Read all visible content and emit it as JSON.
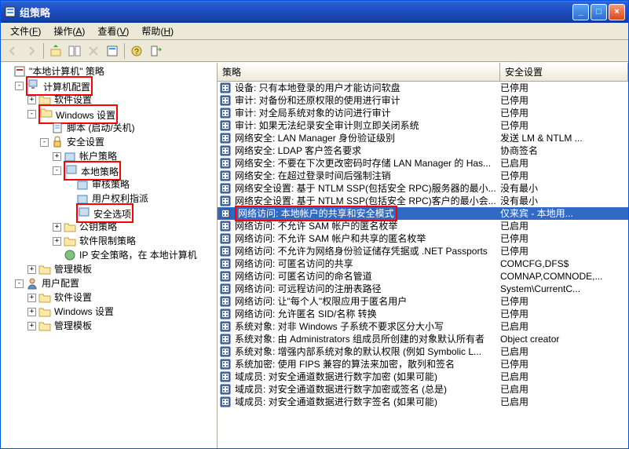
{
  "window": {
    "title": "组策略"
  },
  "menu": {
    "file": "文件",
    "file_u": "F",
    "action": "操作",
    "action_u": "A",
    "view": "查看",
    "view_u": "V",
    "help": "帮助",
    "help_u": "H"
  },
  "tree": {
    "root": "\"本地计算机\" 策略",
    "computer_config": "计算机配置",
    "software_settings": "软件设置",
    "windows_settings": "Windows 设置",
    "scripts": "脚本 (启动/关机)",
    "security_settings": "安全设置",
    "account_policy": "帐户策略",
    "local_policy": "本地策略",
    "audit_policy": "审核策略",
    "user_rights": "用户权利指派",
    "security_options": "安全选项",
    "public_key": "公钥策略",
    "software_restrict": "软件限制策略",
    "ip_security": "IP 安全策略，在 本地计算机",
    "admin_templates": "管理模板",
    "user_config": "用户配置",
    "software_settings2": "软件设置",
    "windows_settings2": "Windows 设置",
    "admin_templates2": "管理模板"
  },
  "list": {
    "header": {
      "policy": "策略",
      "security_setting": "安全设置"
    },
    "rows": [
      {
        "name": "设备: 只有本地登录的用户才能访问软盘",
        "value": "已停用"
      },
      {
        "name": "审计: 对备份和还原权限的使用进行审计",
        "value": "已停用"
      },
      {
        "name": "审计: 对全局系统对象的访问进行审计",
        "value": "已停用"
      },
      {
        "name": "审计: 如果无法纪录安全审计则立即关闭系统",
        "value": "已停用"
      },
      {
        "name": "网络安全: LAN Manager 身份验证级别",
        "value": "发送 LM & NTLM ..."
      },
      {
        "name": "网络安全: LDAP 客户签名要求",
        "value": "协商签名"
      },
      {
        "name": "网络安全: 不要在下次更改密码时存储 LAN Manager 的 Has...",
        "value": "已启用"
      },
      {
        "name": "网络安全: 在超过登录时间后强制注销",
        "value": "已停用"
      },
      {
        "name": "网络安全设置: 基于 NTLM SSP(包括安全 RPC)服务器的最小...",
        "value": "没有最小"
      },
      {
        "name": "网络安全设置: 基于 NTLM SSP(包括安全 RPC)客户的最小会...",
        "value": "没有最小"
      },
      {
        "name": "网络访问: 本地帐户的共享和安全模式",
        "value": "仅来宾 - 本地用...",
        "selected": true,
        "hl": true
      },
      {
        "name": "网络访问: 不允许 SAM 帐户的匿名枚举",
        "value": "已启用"
      },
      {
        "name": "网络访问: 不允许 SAM 帐户和共享的匿名枚举",
        "value": "已停用"
      },
      {
        "name": "网络访问: 不允许为网络身份验证储存凭据或 .NET Passports",
        "value": "已停用"
      },
      {
        "name": "网络访问: 可匿名访问的共享",
        "value": "COMCFG,DFS$"
      },
      {
        "name": "网络访问: 可匿名访问的命名管道",
        "value": "COMNAP,COMNODE,..."
      },
      {
        "name": "网络访问: 可远程访问的注册表路径",
        "value": "System\\CurrentC..."
      },
      {
        "name": "网络访问: 让\"每个人\"权限应用于匿名用户",
        "value": "已停用"
      },
      {
        "name": "网络访问: 允许匿名 SID/名称 转换",
        "value": "已停用"
      },
      {
        "name": "系统对象: 对非 Windows 子系统不要求区分大小写",
        "value": "已启用"
      },
      {
        "name": "系统对象: 由 Administrators 组成员所创建的对象默认所有者",
        "value": "Object creator"
      },
      {
        "name": "系统对象: 增强内部系统对象的默认权限 (例如 Symbolic L...",
        "value": "已启用"
      },
      {
        "name": "系统加密: 使用 FIPS 兼容的算法来加密，散列和签名",
        "value": "已停用"
      },
      {
        "name": "域成员: 对安全通道数据进行数字加密 (如果可能)",
        "value": "已启用"
      },
      {
        "name": "域成员: 对安全通道数据进行数字加密或签名 (总是)",
        "value": "已启用"
      },
      {
        "name": "域成员: 对安全通道数据进行数字签名 (如果可能)",
        "value": "已启用"
      }
    ]
  }
}
